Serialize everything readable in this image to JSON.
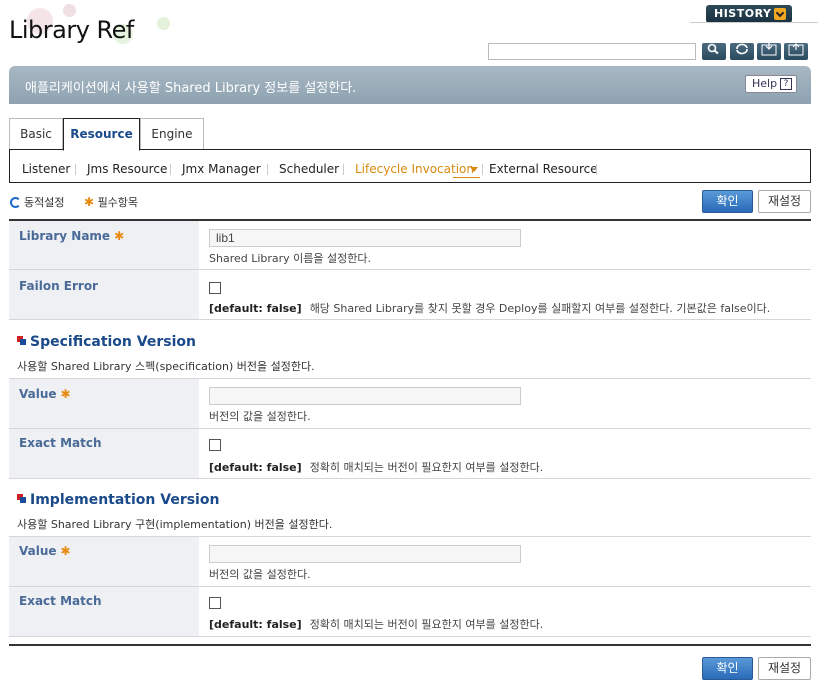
{
  "header": {
    "title": "Library Ref",
    "history_label": "HISTORY",
    "search_placeholder": "",
    "tools": [
      "search-icon",
      "refresh-icon",
      "xml-import-icon",
      "xml-export-icon"
    ]
  },
  "banner": {
    "text": "애플리케이션에서 사용할 Shared Library 정보를 설정한다.",
    "help_label": "Help",
    "help_icon": "?"
  },
  "tabs": [
    {
      "label": "Basic"
    },
    {
      "label": "Resource"
    },
    {
      "label": "Engine"
    }
  ],
  "subnav": [
    {
      "label": "Listener"
    },
    {
      "label": "Jms Resource"
    },
    {
      "label": "Jmx Manager"
    },
    {
      "label": "Scheduler"
    },
    {
      "label": "Lifecycle Invocation"
    },
    {
      "label": "External Resource"
    }
  ],
  "legend": {
    "dynamic": "동적설정",
    "required": "필수항목"
  },
  "actions": {
    "confirm": "확인",
    "reset": "재설정"
  },
  "fields": {
    "library_name": {
      "label": "Library Name",
      "value": "lib1",
      "desc": "Shared Library 이름을 설정한다."
    },
    "failon_error": {
      "label": "Failon Error",
      "default": "[default: false]",
      "desc": "해당 Shared Library를 찾지 못할 경우 Deploy를 실패할지 여부를 설정한다. 기본값은 false이다."
    }
  },
  "spec": {
    "title": "Specification Version",
    "desc": "사용할 Shared Library 스펙(specification) 버전을 설정한다.",
    "value_label": "Value",
    "value": "",
    "value_desc": "버전의 값을 설정한다.",
    "exact_label": "Exact Match",
    "exact_default": "[default: false]",
    "exact_desc": "정확히 매치되는 버전이 필요한지 여부를 설정한다."
  },
  "impl": {
    "title": "Implementation Version",
    "desc": "사용할 Shared Library 구현(implementation) 버전을 설정한다.",
    "value_label": "Value",
    "value": "",
    "value_desc": "버전의 값을 설정한다.",
    "exact_label": "Exact Match",
    "exact_default": "[default: false]",
    "exact_desc": "정확히 매치되는 버전이 필요한지 여부를 설정한다."
  },
  "colors": {
    "accent": "#1a4a8a",
    "active_subnav": "#d88a10",
    "label": "#4a6a98",
    "banner": "#98aab8"
  }
}
